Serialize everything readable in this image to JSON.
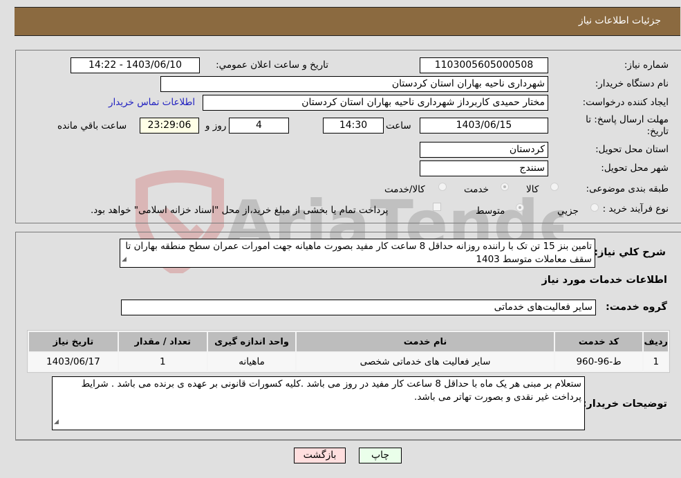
{
  "header": {
    "title": "جزئیات اطلاعات نیاز"
  },
  "details": {
    "need_number_label": "شماره نیاز:",
    "need_number": "1103005605000508",
    "announce_label": "تاریخ و ساعت اعلان عمومي:",
    "announce_value": "1403/06/10 - 14:22",
    "buyer_org_label": "نام دستگاه خريدار:",
    "buyer_org": "شهرداری ناحیه بهاران استان کردستان",
    "requester_label": "ايجاد کننده درخواست:",
    "requester": "مختار حمیدی کاربرداز شهرداری ناحیه بهاران استان کردستان",
    "buyer_contact_link": "اطلاعات تماس خريدار",
    "deadline_label_line1": "مهلت ارسال پاسخ: تا",
    "deadline_label_line2": "تاريخ:",
    "deadline_date": "1403/06/15",
    "time_label": "ساعت",
    "deadline_time": "14:30",
    "days_value": "4",
    "days_label": "روز و",
    "remaining_time": "23:29:06",
    "remaining_label": "ساعت باقي مانده",
    "province_label": "استان محل تحويل:",
    "province": "کردستان",
    "city_label": "شهر محل تحويل:",
    "city": "سنندج",
    "category_label": "طبقه بندی موضوعی:",
    "category_options": [
      {
        "label": "کالا",
        "selected": false
      },
      {
        "label": "خدمت",
        "selected": true
      },
      {
        "label": "کالا/خدمت",
        "selected": false
      }
    ],
    "process_label": "نوع فرآيند خريد :",
    "process_options": [
      {
        "label": "جزيي",
        "selected": false
      },
      {
        "label": "متوسط",
        "selected": true
      }
    ],
    "treasury_checkbox_label": "پرداخت تمام يا بخشی از مبلغ خريد،از محل \"اسناد خزانه اسلامی\" خواهد بود.",
    "treasury_checked": false
  },
  "description": {
    "label": "شرح کلي نياز:",
    "text": "تامین بنز 15 تن تک با راننده روزانه حداقل 8 ساعت کار مفید بصورت ماهیانه جهت امورات عمران سطح منطقه بهاران تا سقف معاملات متوسط 1403"
  },
  "services": {
    "section_title": "اطلاعات خدمات مورد نياز",
    "group_label": "گروه خدمت:",
    "group_value": "سایر فعالیت‌های خدماتی",
    "table": {
      "headers": [
        "رديف",
        "کد خدمت",
        "نام خدمت",
        "واحد اندازه گيری",
        "تعداد / مقدار",
        "تاريخ نياز"
      ],
      "rows": [
        [
          "1",
          "ط-96-960",
          "سایر فعالیت های خدماتی شخصی",
          "ماهیانه",
          "1",
          "1403/06/17"
        ]
      ]
    }
  },
  "buyer_notes": {
    "label": "توضيحات خريدار:",
    "text": "ستعلام بر مبنی هر یک ماه با حداقل 8 ساعت کار مفید در روز می باشد .کلیه کسورات قانونی بر عهده ی برنده می باشد . شرایط پرداخت غیر نقدی و بصورت تهاتر می باشد."
  },
  "buttons": {
    "print": "چاپ",
    "back": "بازگشت"
  },
  "watermark": {
    "text": "AriaTender.neT"
  },
  "colors": {
    "header_bg": "#8b6a40",
    "print_bg": "#eaffea",
    "back_bg": "#ffdede",
    "link": "#2020c0"
  }
}
